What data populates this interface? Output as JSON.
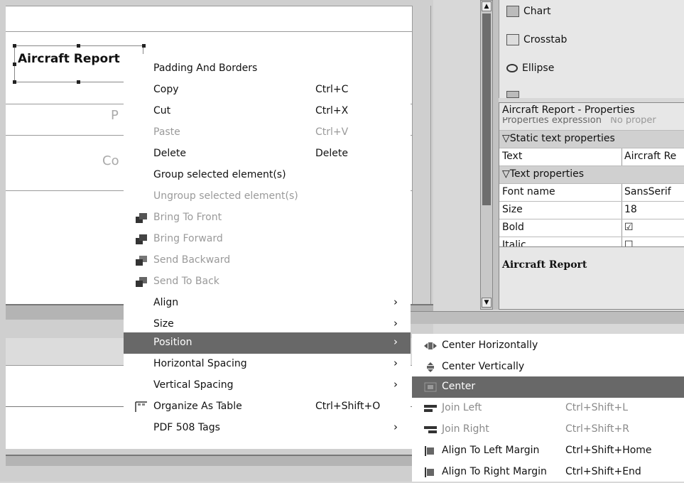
{
  "canvas": {
    "title_element_text": "Aircraft Report",
    "ghost_text_1": "P",
    "ghost_text_2": "Co"
  },
  "palette": {
    "items": [
      {
        "label": "Chart",
        "icon": "chart-icon"
      },
      {
        "label": "Crosstab",
        "icon": "crosstab-icon"
      },
      {
        "label": "Ellipse",
        "icon": "ellipse-icon"
      }
    ]
  },
  "properties": {
    "title": "Aircraft Report - Properties",
    "partial_row": "Properties expression",
    "partial_value": "No proper",
    "sections": [
      {
        "label": "Static text properties",
        "rows": [
          {
            "key": "Text",
            "value": "Aircraft Re"
          }
        ]
      },
      {
        "label": "Text properties",
        "rows": [
          {
            "key": "Font name",
            "value": "SansSerif"
          },
          {
            "key": "Size",
            "value": "18"
          },
          {
            "key": "Bold",
            "value": "☑"
          },
          {
            "key": "Italic",
            "value": "☐"
          }
        ]
      }
    ],
    "description": "Aircraft Report"
  },
  "context_menu": {
    "items": [
      {
        "label": "Padding And Borders",
        "shortcut": "",
        "disabled": false
      },
      {
        "label": "Copy",
        "shortcut": "Ctrl+C",
        "disabled": false
      },
      {
        "label": "Cut",
        "shortcut": "Ctrl+X",
        "disabled": false
      },
      {
        "label": "Paste",
        "shortcut": "Ctrl+V",
        "disabled": true
      },
      {
        "label": "Delete",
        "shortcut": "Delete",
        "disabled": false
      },
      {
        "label": "Group selected element(s)",
        "shortcut": "",
        "disabled": false
      },
      {
        "label": "Ungroup selected element(s)",
        "shortcut": "",
        "disabled": true
      },
      {
        "label": "Bring To Front",
        "shortcut": "",
        "disabled": true,
        "icon": "bring-to-front-icon"
      },
      {
        "label": "Bring Forward",
        "shortcut": "",
        "disabled": true,
        "icon": "bring-forward-icon"
      },
      {
        "label": "Send Backward",
        "shortcut": "",
        "disabled": true,
        "icon": "send-backward-icon"
      },
      {
        "label": "Send To Back",
        "shortcut": "",
        "disabled": true,
        "icon": "send-to-back-icon"
      },
      {
        "label": "Align",
        "shortcut": "",
        "disabled": false,
        "submenu": true
      },
      {
        "label": "Size",
        "shortcut": "",
        "disabled": false,
        "submenu": true
      },
      {
        "label": "Position",
        "shortcut": "",
        "disabled": false,
        "submenu": true,
        "active": true
      },
      {
        "label": "Horizontal Spacing",
        "shortcut": "",
        "disabled": false,
        "submenu": true
      },
      {
        "label": "Vertical Spacing",
        "shortcut": "",
        "disabled": false,
        "submenu": true
      },
      {
        "label": "Organize As Table",
        "shortcut": "Ctrl+Shift+O",
        "disabled": false,
        "icon": "organize-table-icon"
      },
      {
        "label": "PDF 508 Tags",
        "shortcut": "",
        "disabled": false,
        "submenu": true
      }
    ],
    "submenu_arrow": "›"
  },
  "position_submenu": {
    "items": [
      {
        "label": "Center Horizontally",
        "shortcut": "",
        "disabled": false,
        "icon": "center-horizontally-icon"
      },
      {
        "label": "Center Vertically",
        "shortcut": "",
        "disabled": false,
        "icon": "center-vertically-icon"
      },
      {
        "label": "Center",
        "shortcut": "",
        "disabled": false,
        "active": true,
        "icon": "center-icon"
      },
      {
        "label": "Join Left",
        "shortcut": "Ctrl+Shift+L",
        "disabled": true,
        "icon": "join-left-icon"
      },
      {
        "label": "Join Right",
        "shortcut": "Ctrl+Shift+R",
        "disabled": true,
        "icon": "join-right-icon"
      },
      {
        "label": "Align To Left Margin",
        "shortcut": "Ctrl+Shift+Home",
        "disabled": false,
        "icon": "align-left-margin-icon"
      },
      {
        "label": "Align To Right Margin",
        "shortcut": "Ctrl+Shift+End",
        "disabled": false,
        "icon": "align-right-margin-icon"
      }
    ]
  }
}
